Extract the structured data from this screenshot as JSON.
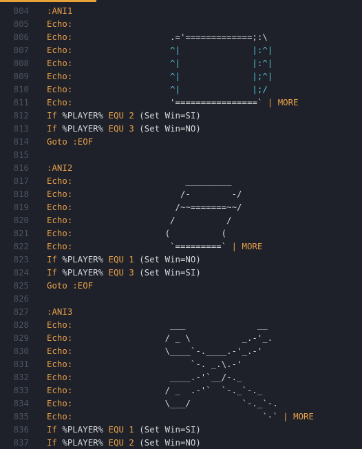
{
  "editor": {
    "lines": [
      {
        "n": "804",
        "c": [
          [
            "lbl",
            ":ANI1"
          ]
        ]
      },
      {
        "n": "805",
        "c": [
          [
            "kw",
            "Echo:"
          ]
        ]
      },
      {
        "n": "806",
        "c": [
          [
            "kw",
            "Echo:"
          ],
          [
            "art",
            "                   .='=============;:\\"
          ]
        ]
      },
      {
        "n": "807",
        "c": [
          [
            "kw",
            "Echo:"
          ],
          [
            "cy",
            "                   ^|"
          ],
          [
            "art",
            "              "
          ],
          [
            "cy",
            "|:^|"
          ]
        ]
      },
      {
        "n": "808",
        "c": [
          [
            "kw",
            "Echo:"
          ],
          [
            "cy",
            "                   ^|"
          ],
          [
            "art",
            "              "
          ],
          [
            "cy",
            "|:^|"
          ]
        ]
      },
      {
        "n": "809",
        "c": [
          [
            "kw",
            "Echo:"
          ],
          [
            "cy",
            "                   ^|"
          ],
          [
            "art",
            "              "
          ],
          [
            "cy",
            "|;^|"
          ]
        ]
      },
      {
        "n": "810",
        "c": [
          [
            "kw",
            "Echo:"
          ],
          [
            "cy",
            "                   ^|"
          ],
          [
            "art",
            "              "
          ],
          [
            "cy",
            "|;/"
          ]
        ]
      },
      {
        "n": "811",
        "c": [
          [
            "kw",
            "Echo:"
          ],
          [
            "art",
            "                   '================`"
          ],
          [
            "pipe",
            " | "
          ],
          [
            "more",
            "MORE"
          ]
        ]
      },
      {
        "n": "812",
        "c": [
          [
            "kw",
            "If "
          ],
          [
            "var",
            "%PLAYER% "
          ],
          [
            "op",
            "EQU "
          ],
          [
            "num",
            "2 "
          ],
          [
            "txt",
            "(Set Win=SI)"
          ]
        ]
      },
      {
        "n": "813",
        "c": [
          [
            "kw",
            "If "
          ],
          [
            "var",
            "%PLAYER% "
          ],
          [
            "op",
            "EQU "
          ],
          [
            "num",
            "3 "
          ],
          [
            "txt",
            "(Set Win=NO)"
          ]
        ]
      },
      {
        "n": "814",
        "c": [
          [
            "kw",
            "Goto "
          ],
          [
            "lbl",
            ":EOF"
          ]
        ]
      },
      {
        "n": "815",
        "c": []
      },
      {
        "n": "816",
        "c": [
          [
            "lbl",
            ":ANI2"
          ]
        ]
      },
      {
        "n": "817",
        "c": [
          [
            "kw",
            "Echo:"
          ],
          [
            "art",
            "                      _________"
          ]
        ]
      },
      {
        "n": "818",
        "c": [
          [
            "kw",
            "Echo:"
          ],
          [
            "art",
            "                     /-        -/"
          ]
        ]
      },
      {
        "n": "819",
        "c": [
          [
            "kw",
            "Echo:"
          ],
          [
            "art",
            "                    /~~=======~~/"
          ]
        ]
      },
      {
        "n": "820",
        "c": [
          [
            "kw",
            "Echo:"
          ],
          [
            "art",
            "                   /          /"
          ]
        ]
      },
      {
        "n": "821",
        "c": [
          [
            "kw",
            "Echo:"
          ],
          [
            "art",
            "                  (          ("
          ]
        ]
      },
      {
        "n": "822",
        "c": [
          [
            "kw",
            "Echo:"
          ],
          [
            "art",
            "                   `=========`"
          ],
          [
            "pipe",
            " | "
          ],
          [
            "more",
            "MORE"
          ]
        ]
      },
      {
        "n": "823",
        "c": [
          [
            "kw",
            "If "
          ],
          [
            "var",
            "%PLAYER% "
          ],
          [
            "op",
            "EQU "
          ],
          [
            "num",
            "1 "
          ],
          [
            "txt",
            "(Set Win=NO)"
          ]
        ]
      },
      {
        "n": "824",
        "c": [
          [
            "kw",
            "If "
          ],
          [
            "var",
            "%PLAYER% "
          ],
          [
            "op",
            "EQU "
          ],
          [
            "num",
            "3 "
          ],
          [
            "txt",
            "(Set Win=SI)"
          ]
        ]
      },
      {
        "n": "825",
        "c": [
          [
            "kw",
            "Goto "
          ],
          [
            "lbl",
            ":EOF"
          ]
        ]
      },
      {
        "n": "826",
        "c": []
      },
      {
        "n": "827",
        "c": [
          [
            "lbl",
            ":ANI3"
          ]
        ]
      },
      {
        "n": "828",
        "c": [
          [
            "kw",
            "Echo:"
          ],
          [
            "art",
            "                   ___              __"
          ]
        ]
      },
      {
        "n": "829",
        "c": [
          [
            "kw",
            "Echo:"
          ],
          [
            "art",
            "                  / _ \\          _.-'_."
          ]
        ]
      },
      {
        "n": "830",
        "c": [
          [
            "kw",
            "Echo:"
          ],
          [
            "art",
            "                  \\____`-.____.-'_.-'"
          ]
        ]
      },
      {
        "n": "831",
        "c": [
          [
            "kw",
            "Echo:"
          ],
          [
            "art",
            "                       `-. _.\\.-'"
          ]
        ]
      },
      {
        "n": "832",
        "c": [
          [
            "kw",
            "Echo:"
          ],
          [
            "art",
            "                   ____.-'`__/-._"
          ]
        ]
      },
      {
        "n": "833",
        "c": [
          [
            "kw",
            "Echo:"
          ],
          [
            "art",
            "                  / _  .-'`  `-._`-._"
          ]
        ]
      },
      {
        "n": "834",
        "c": [
          [
            "kw",
            "Echo:"
          ],
          [
            "art",
            "                  \\___/          `-._`-."
          ]
        ]
      },
      {
        "n": "835",
        "c": [
          [
            "kw",
            "Echo:"
          ],
          [
            "art",
            "                                     `-`"
          ],
          [
            "pipe",
            " | "
          ],
          [
            "more",
            "MORE"
          ]
        ]
      },
      {
        "n": "836",
        "c": [
          [
            "kw",
            "If "
          ],
          [
            "var",
            "%PLAYER% "
          ],
          [
            "op",
            "EQU "
          ],
          [
            "num",
            "1 "
          ],
          [
            "txt",
            "(Set Win=SI)"
          ]
        ]
      },
      {
        "n": "837",
        "c": [
          [
            "kw",
            "If "
          ],
          [
            "var",
            "%PLAYER% "
          ],
          [
            "op",
            "EQU "
          ],
          [
            "num",
            "2 "
          ],
          [
            "txt",
            "(Set Win=NO)"
          ]
        ]
      }
    ]
  }
}
